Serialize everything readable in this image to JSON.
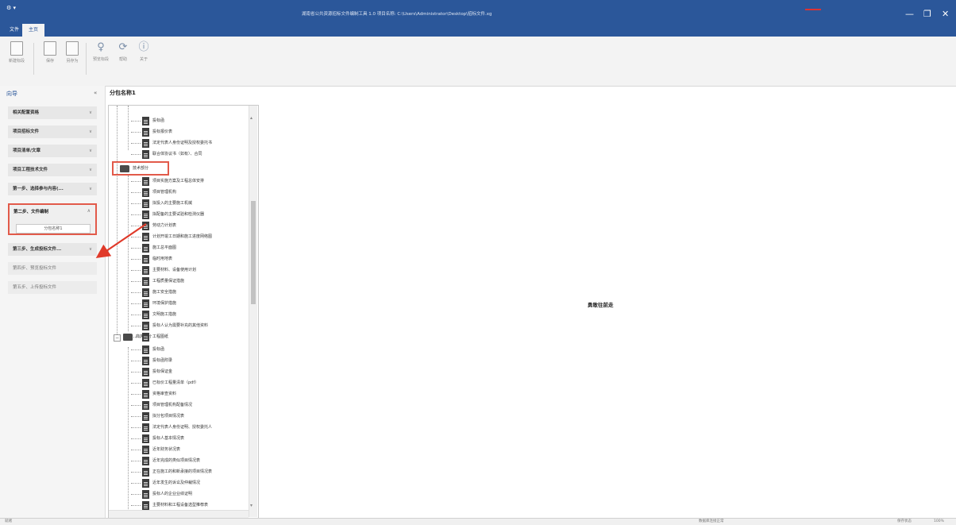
{
  "window": {
    "title": "湖南省公共资源招标文件编制工具 1.0 项目名称: C:\\Users\\Administrator\\Desktop\\招标文件.xg",
    "icon": "app-icon",
    "controls": [
      "—",
      "❐",
      "✕"
    ]
  },
  "menu": {
    "tabs": [
      {
        "label": "文件",
        "active": false
      },
      {
        "label": "主页",
        "active": true
      }
    ]
  },
  "ribbon": {
    "buttons": [
      {
        "label": "新建标段",
        "icon": "new-section-icon"
      },
      {
        "label": "保存",
        "icon": "save-icon"
      },
      {
        "label": "另存为",
        "icon": "save-as-icon"
      },
      {
        "label": "预览标段",
        "icon": "preview-icon"
      },
      {
        "label": "帮助",
        "icon": "help-icon"
      },
      {
        "label": "关于",
        "icon": "about-icon"
      }
    ]
  },
  "nav": {
    "title": "向导",
    "collapse": "«",
    "items": [
      {
        "label": "相关配置资格",
        "chevron": "∨"
      },
      {
        "label": "项目招标文件",
        "chevron": "∨"
      },
      {
        "label": "项目清单/文章",
        "chevron": "∨"
      },
      {
        "label": "项目工程技术文件",
        "chevron": "∨"
      },
      {
        "label": "第一步、选择参与内容(...",
        "chevron": "∨"
      }
    ],
    "expanded": {
      "label": "第二步、文件编制",
      "chevron": "∧",
      "sub": "分包名称1"
    },
    "after": [
      {
        "label": "第三步、生成投标文件...",
        "chevron": "∨"
      }
    ],
    "plain": [
      {
        "label": "第四步、预览投标文件"
      },
      {
        "label": "第五步、上传投标文件"
      }
    ]
  },
  "tree": {
    "title": "分包名称1",
    "top_items": [
      "投标函",
      "投标报价表",
      "法定代表人身份证明及授权委托书",
      "联合体协议书（如有）、合同"
    ],
    "group1": {
      "label": "技术部分",
      "items": [
        "项目实施方案及工程总体安排",
        "项目管理机构",
        "拟投入的主要施工机械",
        "拟配备的主要试验和检测仪器",
        "劳动力计划表",
        "计划开竣工日期和施工进度网络图",
        "施工总平面图",
        "临时用地表",
        "主要材料、设备使用计划",
        "工程质量保证措施",
        "施工安全措施",
        "环境保护措施",
        "文明施工措施",
        "投标人认为需要补充的其他资料",
        "工程图纸"
      ]
    },
    "group2": {
      "label": "商务部分",
      "items": [
        "投标函",
        "投标函附录",
        "投标保证金",
        "已标价工程量清单（pdf）",
        "资格审查资料",
        "项目管理机构配备情况",
        "拟分包项目情况表",
        "法定代表人身份证明、授权委托人",
        "投标人基本情况表",
        "近年财务状况表",
        "近年完成的类似项目情况表",
        "正在施工的和新承接的项目情况表",
        "近年发生的诉讼及仲裁情况",
        "投标人的企业业绩证明",
        "主要材料和工程设备选型推荐表"
      ]
    }
  },
  "main": {
    "center_label": "勇敢往前走"
  },
  "status": {
    "left": "就绪",
    "middle": "数据库连接正常",
    "right": "保存状态",
    "zoom": "100%"
  }
}
